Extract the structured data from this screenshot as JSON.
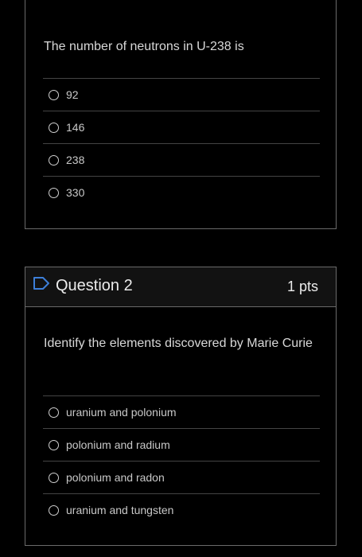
{
  "question1": {
    "prompt": "The number of neutrons in U-238 is",
    "answers": [
      "92",
      "146",
      "238",
      "330"
    ]
  },
  "question2": {
    "title": "Question 2",
    "points": "1 pts",
    "prompt": "Identify the elements discovered by Marie Curie",
    "answers": [
      "uranium and polonium",
      "polonium and radium",
      "polonium and radon",
      "uranium and tungsten"
    ]
  },
  "colors": {
    "background": "#000000",
    "border": "#6a6a6a",
    "text": "#d8d8d8",
    "flag": "#3d7fd9"
  }
}
